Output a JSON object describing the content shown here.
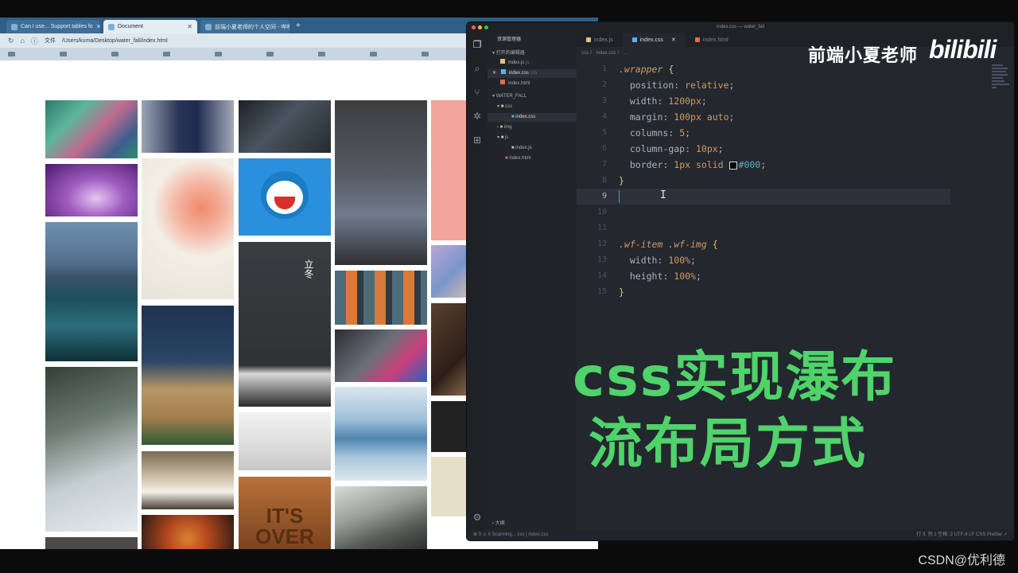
{
  "browser": {
    "tabs": [
      {
        "label": "Can I use... Support tables fo",
        "active": false
      },
      {
        "label": "Document",
        "active": true
      },
      {
        "label": "前端小夏老师的个人空间 - 哔哩",
        "active": false
      }
    ],
    "new_tab": "+",
    "address_prefix": "文件",
    "address": "/Users/kuma/Desktop/water_fall/index.html"
  },
  "waterfall_images": [
    {
      "subject": "leaves-pattern",
      "overlay": ""
    },
    {
      "subject": "purple-gradient",
      "overlay": ""
    },
    {
      "subject": "venice-canal",
      "overlay": ""
    },
    {
      "subject": "wind-chime",
      "overlay": ""
    },
    {
      "subject": "footballer",
      "overlay": ""
    },
    {
      "subject": "grapefruit-slices",
      "overlay": ""
    },
    {
      "subject": "paper-mountains",
      "overlay": ""
    },
    {
      "subject": "bedroom",
      "overlay": ""
    },
    {
      "subject": "pizza",
      "overlay": ""
    },
    {
      "subject": "dark-scene",
      "overlay": ""
    },
    {
      "subject": "doraemon",
      "overlay": ""
    },
    {
      "subject": "lidong-poster",
      "overlay": "立冬"
    },
    {
      "subject": "paper-boat",
      "overlay": ""
    },
    {
      "subject": "wood-texture",
      "overlay": "IT'S OVER"
    },
    {
      "subject": "cartoon-characters",
      "overlay": ""
    },
    {
      "subject": "striped-figures",
      "overlay": ""
    },
    {
      "subject": "laptop-typing",
      "overlay": ""
    },
    {
      "subject": "sky-reflection",
      "overlay": ""
    },
    {
      "subject": "snow-mountains",
      "overlay": ""
    },
    {
      "subject": "pink-block",
      "overlay": ""
    },
    {
      "subject": "anime-scene",
      "overlay": ""
    },
    {
      "subject": "portrait",
      "overlay": ""
    }
  ],
  "editor": {
    "window_title": "index.css — water_fall",
    "explorer": {
      "title": "资源管理器",
      "open_editors_label": "打开的编辑器",
      "open_editors": [
        {
          "name": "index.js",
          "tag": "js"
        },
        {
          "name": "index.css",
          "tag": "css"
        },
        {
          "name": "index.html",
          "tag": ""
        }
      ],
      "project_label": "WATER_FALL",
      "tree": [
        {
          "name": "css",
          "kind": "folder"
        },
        {
          "name": "index.css",
          "kind": "file"
        },
        {
          "name": "img",
          "kind": "folder"
        },
        {
          "name": "js",
          "kind": "folder"
        },
        {
          "name": "index.js",
          "kind": "file"
        },
        {
          "name": "index.html",
          "kind": "file"
        }
      ],
      "outline_label": "大纲"
    },
    "tabs": [
      {
        "label": "index.js",
        "active": false
      },
      {
        "label": "index.css",
        "active": true
      },
      {
        "label": "index.html",
        "active": false
      }
    ],
    "breadcrumb": "css 〉 index.css 〉 ...",
    "line_numbers": [
      "1",
      "2",
      "3",
      "4",
      "5",
      "6",
      "7",
      "8",
      "9",
      "10",
      "11",
      "12",
      "13",
      "14",
      "15"
    ],
    "code": {
      "l1_selector": ".wrapper",
      "l1_brace": "{",
      "l2_prop": "position:",
      "l2_val": "relative",
      "l3_prop": "width:",
      "l3_val": "1200px",
      "l4_prop": "margin:",
      "l4_val": "100px auto",
      "l5_prop": "columns:",
      "l5_val": "5",
      "l6_prop": "column-gap:",
      "l6_val": "10px",
      "l7_prop": "border:",
      "l7_val": "1px solid",
      "l7_hex": "#000",
      "l8_brace": "}",
      "l12_selector": ".wf-item .wf-img",
      "l12_brace": "{",
      "l13_prop": "width:",
      "l13_val": "100%",
      "l14_prop": "height:",
      "l14_val": "100%",
      "l15_brace": "}",
      "semicolon": ";"
    },
    "status": {
      "left": "⊗ 0  ⚠ 0    Scanning...     css | index.css",
      "right": "行 9, 列 1    空格: 2    UTF-8    LF    CSS    Prettier ✓"
    }
  },
  "overlays": {
    "brand": "前端小夏老师",
    "bili": "bilibili",
    "headline_line1": "css实现瀑布",
    "headline_line2": "流布局方式",
    "watermark": "CSDN@优利德",
    "headline_color": "#4fd36a"
  }
}
